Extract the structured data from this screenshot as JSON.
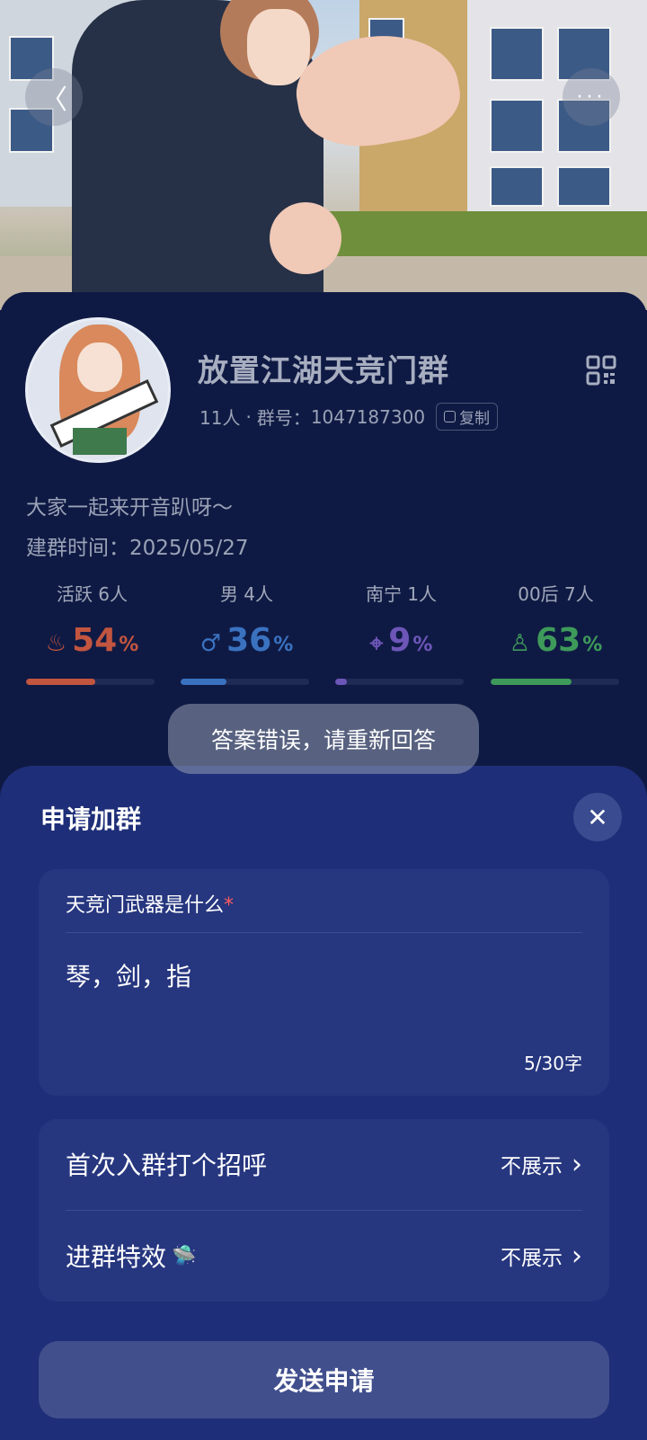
{
  "header": {
    "back_icon": "chevron-left-icon",
    "more_icon": "more-dots-icon",
    "more_glyph": "···",
    "back_glyph": "〈"
  },
  "group": {
    "name": "放置江湖天竞门群",
    "members": "11人",
    "separator": "·",
    "id_label": "群号：",
    "id": "1047187300",
    "copy_label": "复制",
    "description": "大家一起来开音趴呀～",
    "created_label": "建群时间：",
    "created_date": "2025/05/27"
  },
  "stats": [
    {
      "label": "活跃 6人",
      "icon": "flame-icon",
      "glyph": "♨",
      "value": "54",
      "unit": "%",
      "color": "#c2553f",
      "percent": 0.54
    },
    {
      "label": "男 4人",
      "icon": "male-icon",
      "glyph": "♂",
      "value": "36",
      "unit": "%",
      "color": "#3a72c0",
      "percent": 0.36
    },
    {
      "label": "南宁 1人",
      "icon": "location-icon",
      "glyph": "⌖",
      "value": "9",
      "unit": "%",
      "color": "#6d56b8",
      "percent": 0.09
    },
    {
      "label": "00后 7人",
      "icon": "person-icon",
      "glyph": "♙",
      "value": "63",
      "unit": "%",
      "color": "#3e9a5a",
      "percent": 0.63
    }
  ],
  "toast": "答案错误，请重新回答",
  "sheet": {
    "title": "申请加群",
    "close_glyph": "✕",
    "question": "天竞门武器是什么",
    "required_mark": "*",
    "answer": "琴，剑，指",
    "char_count": "5/30字",
    "options": [
      {
        "label": "首次入群打个招呼",
        "value": "不展示"
      },
      {
        "label": "进群特效",
        "value": "不展示",
        "emoji": "🛸"
      }
    ],
    "chevron_glyph": "›",
    "send_label": "发送申请"
  }
}
